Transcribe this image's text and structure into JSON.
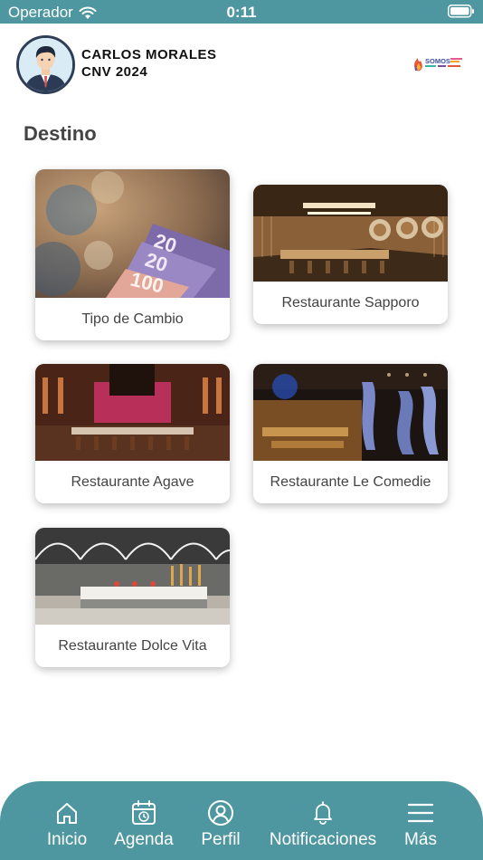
{
  "status_bar": {
    "carrier": "Operador",
    "time": "0:11"
  },
  "header": {
    "user_name": "CARLOS MORALES",
    "event": "CNV 2024",
    "logo_text": "SOMOS"
  },
  "page": {
    "title": "Destino"
  },
  "cards": [
    {
      "label": "Tipo de Cambio"
    },
    {
      "label": "Restaurante Sapporo"
    },
    {
      "label": "Restaurante Agave"
    },
    {
      "label": "Restaurante Le Comedie"
    },
    {
      "label": "Restaurante Dolce Vita"
    }
  ],
  "bottom_nav": {
    "items": [
      {
        "label": "Inicio",
        "icon": "home-icon"
      },
      {
        "label": "Agenda",
        "icon": "calendar-icon"
      },
      {
        "label": "Perfil",
        "icon": "user-icon"
      },
      {
        "label": "Notificaciones",
        "icon": "bell-icon"
      },
      {
        "label": "Más",
        "icon": "menu-icon"
      }
    ]
  },
  "colors": {
    "accent": "#4f97a0",
    "background": "#ffffff",
    "text": "#444444"
  }
}
